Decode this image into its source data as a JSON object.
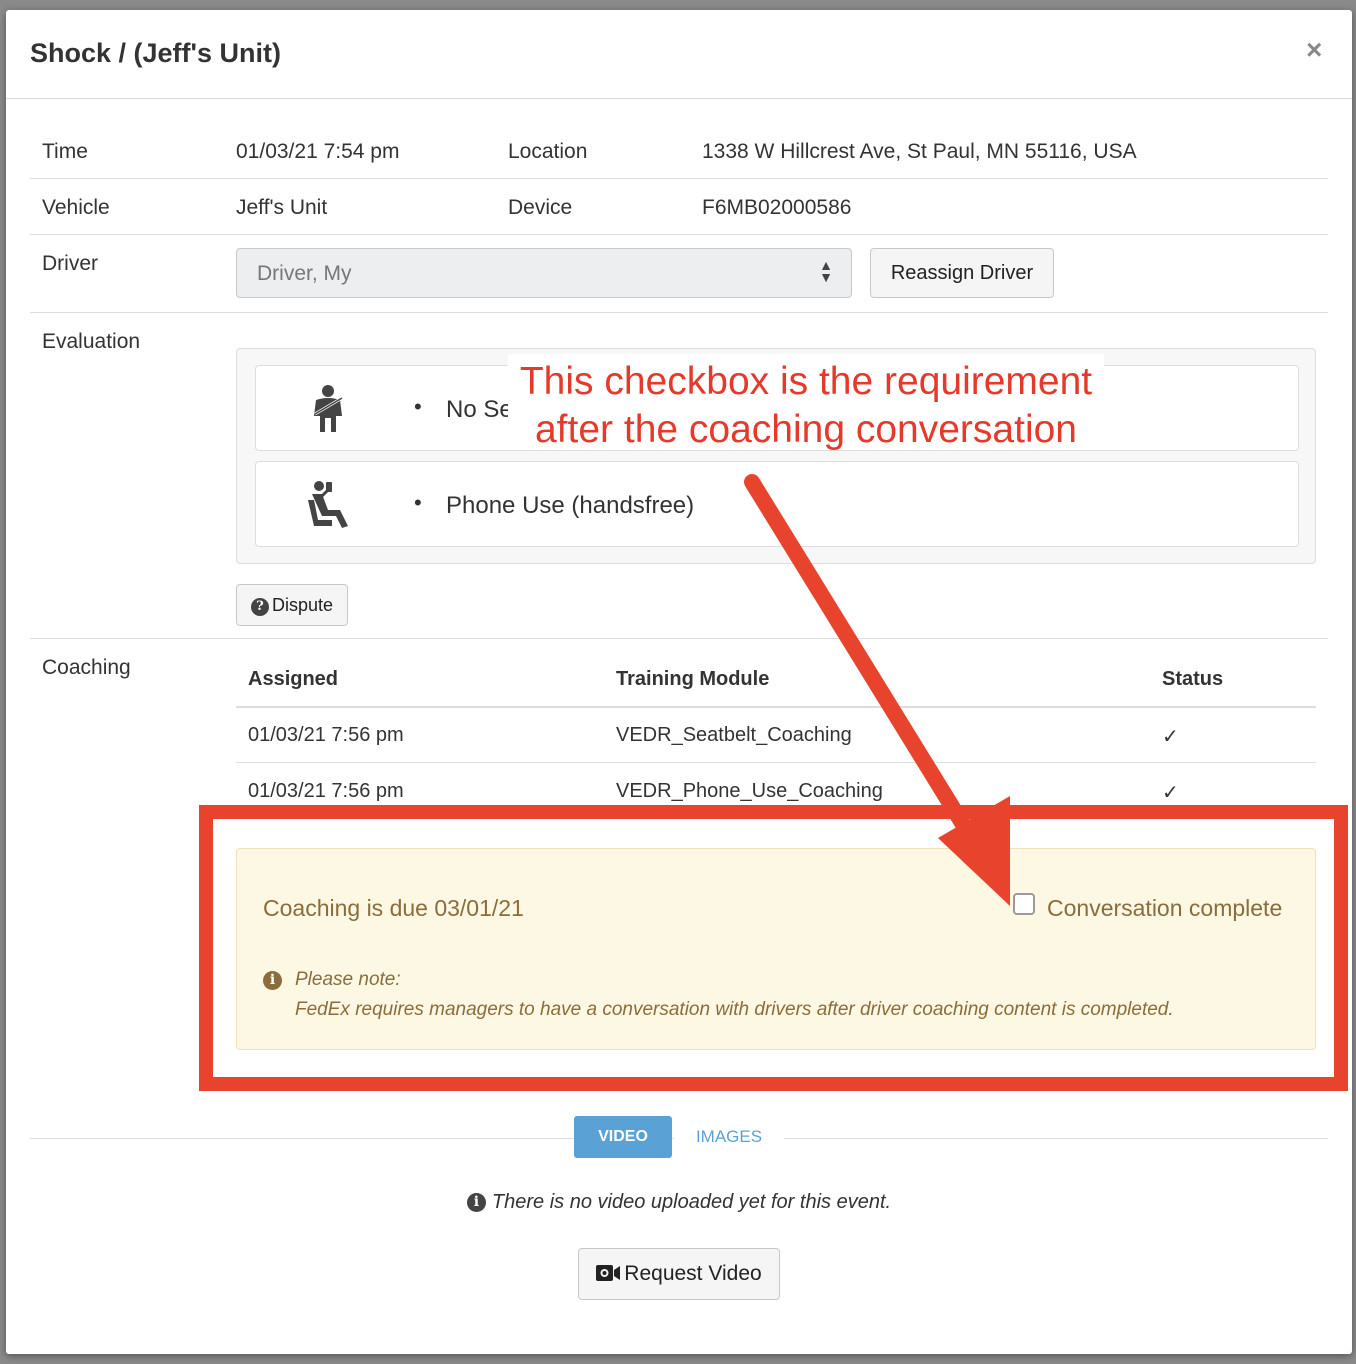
{
  "header": {
    "title": "Shock / (Jeff's Unit)",
    "close": "×"
  },
  "details": {
    "time_label": "Time",
    "time_value": "01/03/21 7:54 pm",
    "location_label": "Location",
    "location_value": "1338 W Hillcrest Ave, St Paul, MN 55116, USA",
    "vehicle_label": "Vehicle",
    "vehicle_value": "Jeff's Unit",
    "device_label": "Device",
    "device_value": "F6MB02000586",
    "driver_label": "Driver",
    "driver_value": "Driver, My",
    "reassign_label": "Reassign Driver"
  },
  "evaluation": {
    "label": "Evaluation",
    "items": [
      {
        "icon": "seatbelt-icon",
        "text": "No Se"
      },
      {
        "icon": "phone-driver-icon",
        "text": "Phone Use (handsfree)"
      }
    ],
    "dispute_label": "Dispute"
  },
  "coaching": {
    "label": "Coaching",
    "columns": [
      "Assigned",
      "Training Module",
      "Status"
    ],
    "rows": [
      {
        "assigned": "01/03/21 7:56 pm",
        "module": "VEDR_Seatbelt_Coaching",
        "status": "✓"
      },
      {
        "assigned": "01/03/21 7:56 pm",
        "module": "VEDR_Phone_Use_Coaching",
        "status": "✓"
      }
    ],
    "due_text": "Coaching is due 03/01/21",
    "conversation_label": "Conversation complete",
    "conversation_checked": false,
    "note_title": "Please note:",
    "note_text": "FedEx requires managers to have a conversation with drivers after driver coaching content is completed."
  },
  "media": {
    "tabs": [
      "VIDEO",
      "IMAGES"
    ],
    "active_tab": "VIDEO",
    "no_video_text": "There is no video uploaded yet for this event.",
    "request_label": "Request Video"
  },
  "annotation": {
    "line1": "This checkbox is the requirement",
    "line2": "after the coaching conversation",
    "color": "#e8432d"
  }
}
